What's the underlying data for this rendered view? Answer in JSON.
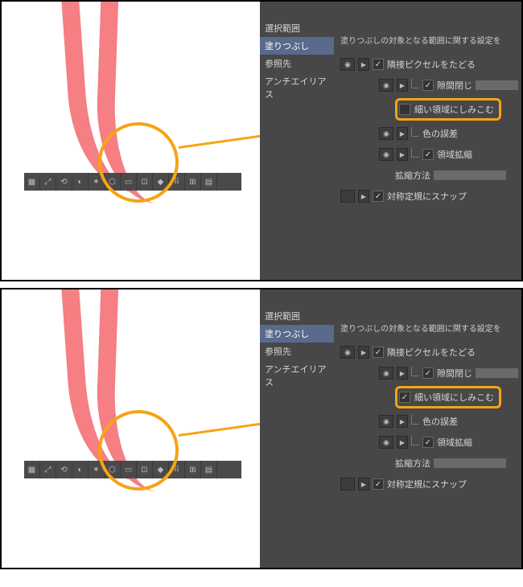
{
  "nav": {
    "item0": "選択範囲",
    "item1": "塗りつぶし",
    "item2": "参照先",
    "item3": "アンチエイリアス"
  },
  "header": {
    "desc": "塗りつぶしの対象となる範囲に関する設定を"
  },
  "settings": {
    "followAdjacent": "隣接ピクセルをたどる",
    "gapClose": "隙間閉じ",
    "seepNarrow": "細い領域にしみこむ",
    "colorTolerance": "色の誤差",
    "areaScaling": "領域拡縮",
    "scalingMethod": "拡縮方法",
    "snapSymmetry": "対称定規にスナップ"
  },
  "variants": {
    "top": {
      "seepChecked": false
    },
    "bottom": {
      "seepChecked": true
    }
  },
  "colors": {
    "accent": "#f7a316",
    "stroke": "#f57f82",
    "panel": "#474747"
  }
}
